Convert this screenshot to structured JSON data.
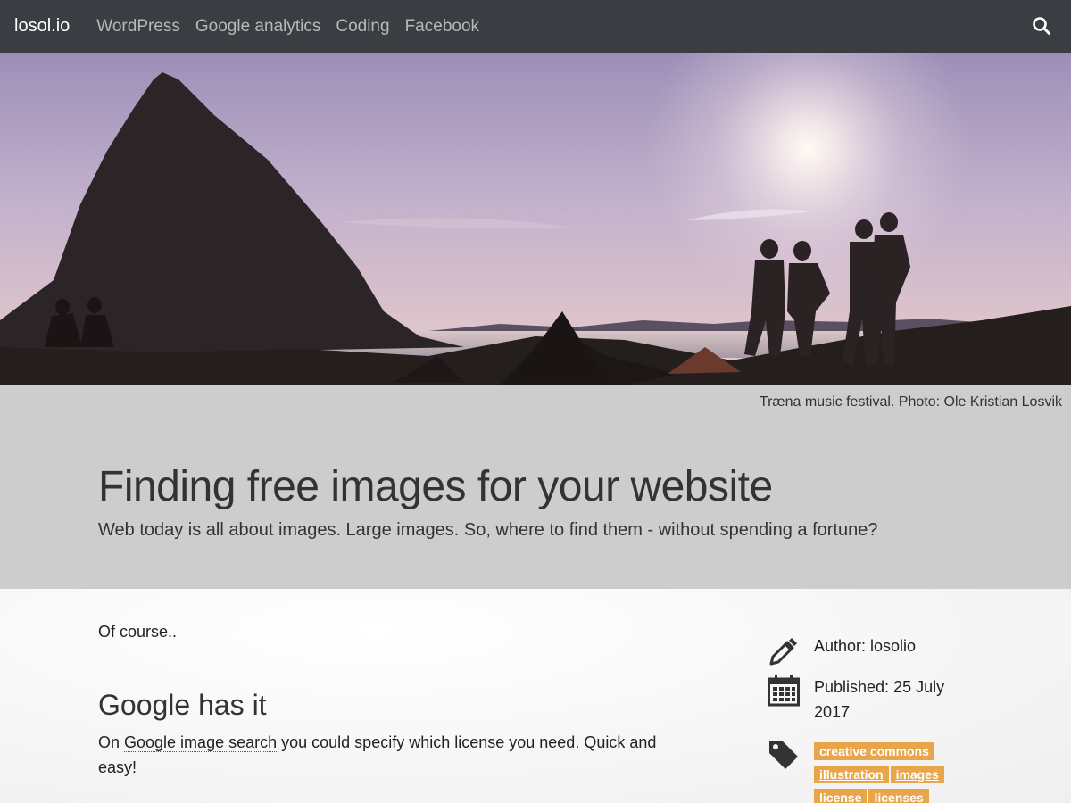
{
  "nav": {
    "brand": "losol.io",
    "links": [
      "WordPress",
      "Google analytics",
      "Coding",
      "Facebook"
    ]
  },
  "hero": {
    "caption": "Træna music festival. Photo: Ole Kristian Losvik"
  },
  "post": {
    "title": "Finding free images for your website",
    "subtitle": "Web today is all about images. Large images. So, where to find them - without spending a fortune?",
    "intro": "Of course..",
    "heading": "Google has it",
    "para_before": "On ",
    "para_link": "Google image search",
    "para_after": " you could specify which license you need. Quick and easy!"
  },
  "meta": {
    "author": "Author: losolio",
    "published": "Published: 25 July 2017",
    "tags": [
      "creative commons",
      "illustration",
      "images",
      "license",
      "licenses"
    ]
  },
  "colors": {
    "navbar": "#3a3e43",
    "band": "#cdcdcd",
    "tag": "#e8a54a"
  }
}
